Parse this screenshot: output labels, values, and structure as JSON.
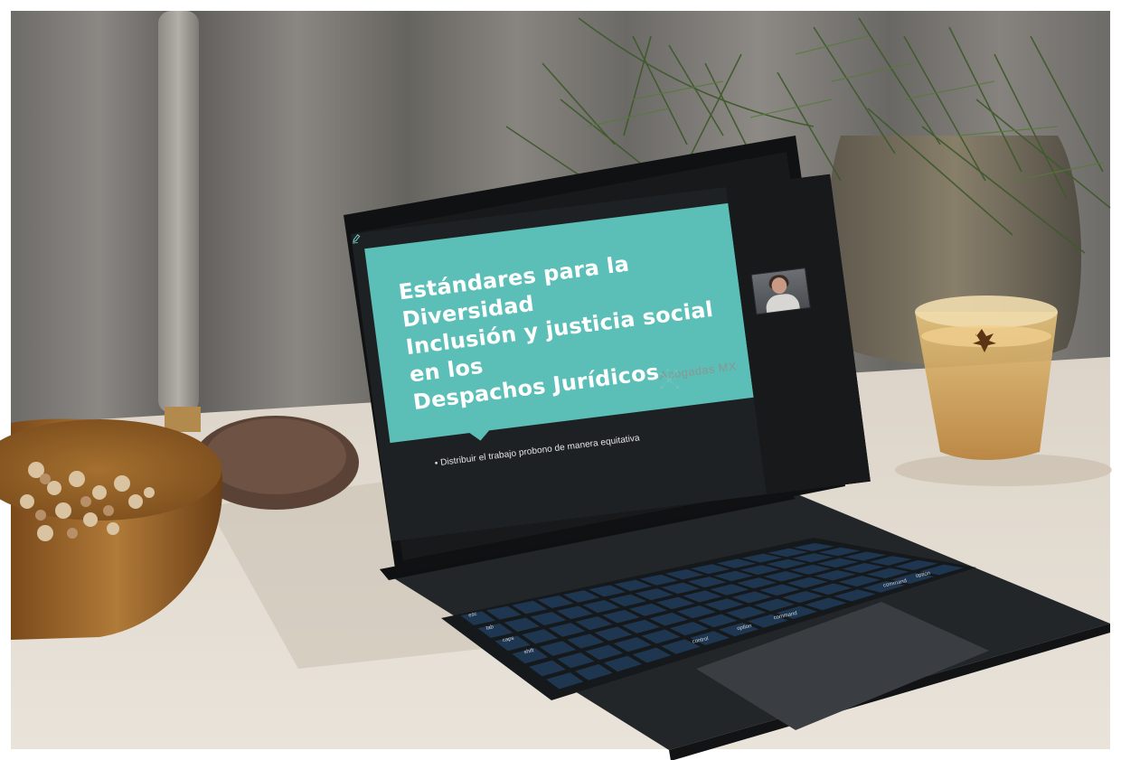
{
  "slide": {
    "title_lines": [
      "Estándares para la Diversidad",
      "Inclusión y justicia social en los",
      "Despachos Jurídicos"
    ],
    "bullet": "• Distribuir el trabajo probono de manera equitativa",
    "logo_name": "Abogadas MX",
    "logo_icon": "network-logo-icon"
  },
  "keyboard": {
    "labels": [
      "command",
      "option",
      "control",
      "command",
      "option",
      "esc",
      "tab",
      "caps",
      "shift"
    ]
  },
  "colors": {
    "slide_accent": "#5bbfb7",
    "slide_background": "#1e2123",
    "key_caps": "#1f3a55"
  }
}
